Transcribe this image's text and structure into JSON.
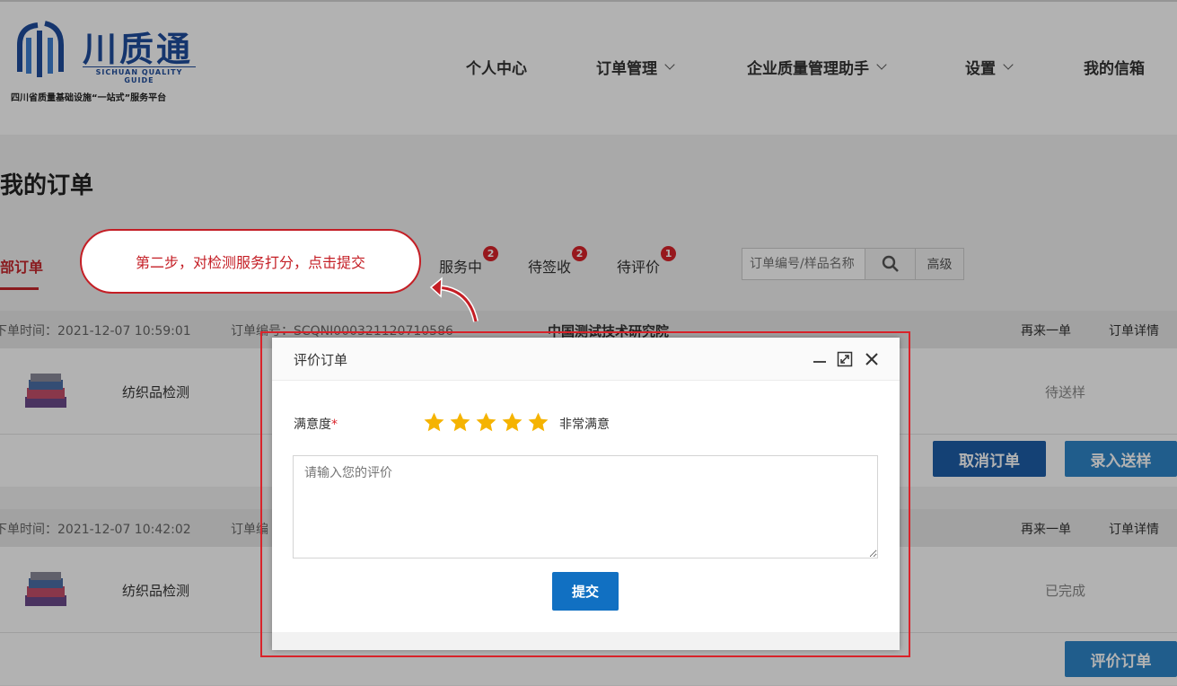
{
  "brand": {
    "title": "川质通",
    "en": "SICHUAN QUALITY GUIDE",
    "subtitle": "四川省质量基础设施“一站式”服务平台",
    "color": "#1f4d9c"
  },
  "nav": {
    "items": [
      {
        "label": "个人中心",
        "dropdown": false
      },
      {
        "label": "订单管理",
        "dropdown": true
      },
      {
        "label": "企业质量管理助手",
        "dropdown": true
      },
      {
        "label": "设置",
        "dropdown": true
      },
      {
        "label": "我的信箱",
        "dropdown": false
      }
    ]
  },
  "page": {
    "title": "我的订单"
  },
  "tabs": {
    "items": [
      {
        "label": "部订单",
        "active": true
      },
      {
        "label": "服务中",
        "badge": "2"
      },
      {
        "label": "待签收",
        "badge": "2"
      },
      {
        "label": "待评价",
        "badge": "1"
      }
    ]
  },
  "search": {
    "placeholder": "订单编号/样品名称",
    "advanced_label": "高级"
  },
  "orders": [
    {
      "time": "下单时间：2021-12-07 10:59:01",
      "order_no": "订单编号：SCQNI000321120710586",
      "org": "中国测试技术研究院",
      "reorder": "再来一单",
      "detail": "订单详情",
      "product": "纺织品检测",
      "status": "待送样",
      "actions": [
        "取消订单",
        "录入送样"
      ]
    },
    {
      "time": "下单时间：2021-12-07 10:42:02",
      "order_no": "订单编",
      "reorder": "再来一单",
      "detail": "订单详情",
      "product": "纺织品检测",
      "status": "已完成",
      "actions": [
        "评价订单"
      ]
    }
  ],
  "callout": {
    "text": "第二步，对检测服务打分，点击提交",
    "color": "#c41e25"
  },
  "modal": {
    "title": "评价订单",
    "satisfaction_label": "满意度",
    "required_mark": "*",
    "rating": 5,
    "rating_max": 5,
    "rating_text": "非常满意",
    "review_placeholder": "请输入您的评价",
    "submit_label": "提交",
    "star_color": "#f5b301",
    "button_color": "#1170c2"
  }
}
